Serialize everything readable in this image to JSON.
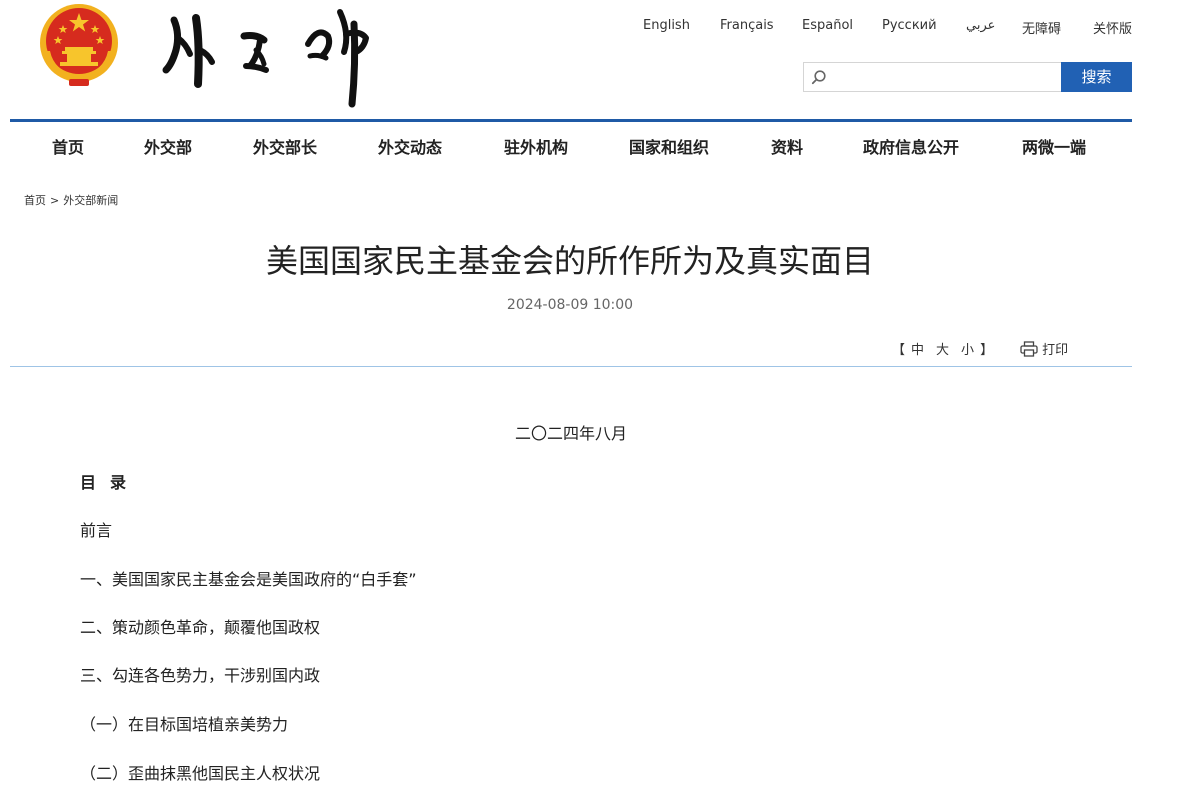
{
  "header": {
    "languages": [
      "English",
      "Français",
      "Español",
      "Русский",
      "عربي",
      "无障碍",
      "关怀版"
    ],
    "search": {
      "placeholder": "",
      "button_label": "搜索"
    },
    "colors": {
      "accent": "#2161b4",
      "nav_rule": "#1f5aa6",
      "emblem_red": "#d62b1e",
      "emblem_gold": "#f2b11f"
    }
  },
  "nav": {
    "items": [
      "首页",
      "外交部",
      "外交部长",
      "外交动态",
      "驻外机构",
      "国家和组织",
      "资料",
      "政府信息公开",
      "两微一端"
    ]
  },
  "breadcrumb": {
    "home": "首页",
    "separator": ">",
    "current": "外交部新闻"
  },
  "article": {
    "title": "美国国家民主基金会的所作所为及真实面目",
    "date": "2024-08-09 10:00",
    "font_size_tools": {
      "open": "【",
      "medium": "中",
      "large": "大",
      "small": "小",
      "close": "】"
    },
    "print_label": "打印",
    "dateline": "二〇二四年八月",
    "toc_heading": "目录",
    "toc_items": [
      "前言",
      "一、美国国家民主基金会是美国政府的“白手套”",
      "二、策动颜色革命，颠覆他国政权",
      "三、勾连各色势力，干涉别国内政",
      "（一）在目标国培植亲美势力",
      "（二）歪曲抹黑他国民主人权状况"
    ]
  }
}
